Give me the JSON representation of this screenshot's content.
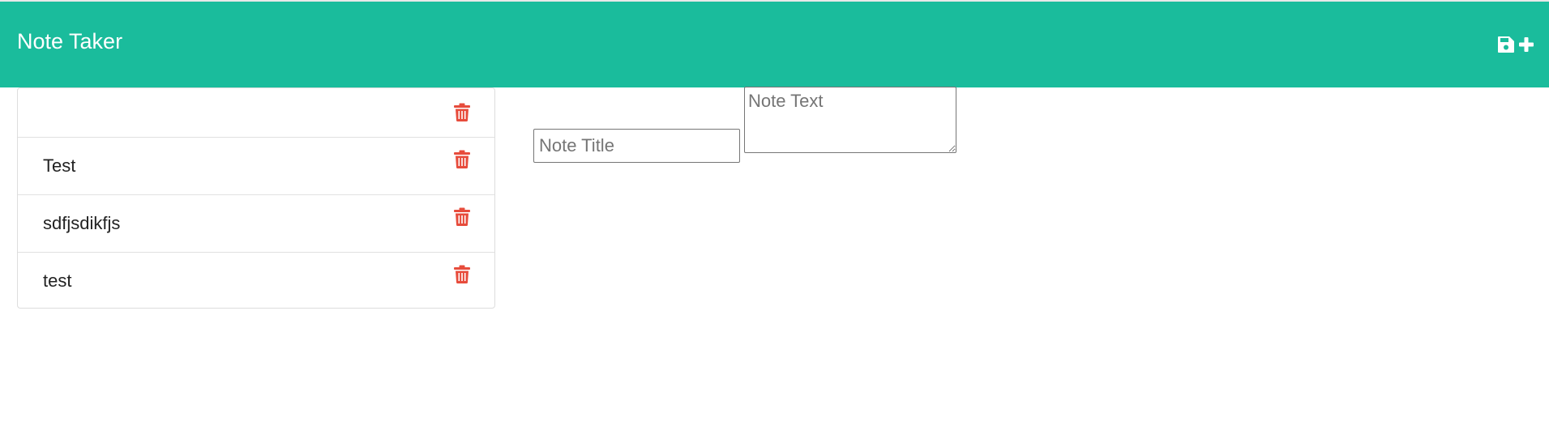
{
  "app": {
    "title": "Note Taker"
  },
  "header": {
    "brand": "Note Taker",
    "actions": [
      {
        "name": "save-icon",
        "label": "save note"
      },
      {
        "name": "plus-icon",
        "label": "new note"
      }
    ]
  },
  "notes": [
    {
      "title": ""
    },
    {
      "title": "Test"
    },
    {
      "title": "sdfjsdikfjs"
    },
    {
      "title": "test"
    }
  ],
  "editor": {
    "title_placeholder": "Note Title",
    "text_placeholder": "Note Text",
    "title_value": "",
    "text_value": ""
  },
  "colors": {
    "navbar": "#1abc9c",
    "nav_text": "#ffffff",
    "delete": "#e74c3c"
  }
}
